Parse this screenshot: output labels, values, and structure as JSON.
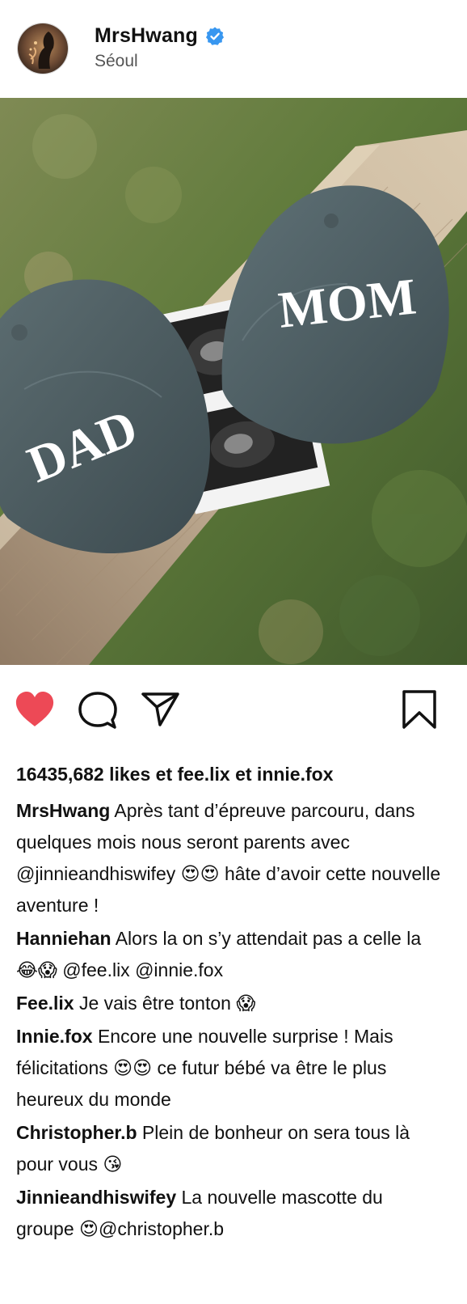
{
  "post": {
    "username": "MrsHwang",
    "verified": true,
    "location": "Séoul",
    "likes_text": "16435,682 likes et fee.lix et innie.fox",
    "liked": true
  },
  "icons": {
    "like": "heart-icon",
    "comment": "comment-bubble-icon",
    "share": "paper-plane-icon",
    "save": "bookmark-icon",
    "verified": "verified-badge-icon"
  },
  "colors": {
    "like_active": "#ED4956",
    "verified_blue": "#3897F0",
    "text": "#111111",
    "secondary_text": "#555555"
  },
  "photo": {
    "cap_left_text": "DAD",
    "cap_right_text": "MOM"
  },
  "caption": {
    "author": "MrsHwang",
    "segments": [
      " Après tant d’épreuve parcouru, dans quelques mois nous seront parents avec ",
      "@jinnieandhiswifey",
      " 😍😍 hâte d’avoir cette nouvelle aventure !"
    ]
  },
  "comments": [
    {
      "author": "Hanniehan",
      "text": " Alors la on s’y attendait pas a celle la 😂😱 ",
      "mentions": [
        "@fee.lix",
        "@innie.fox"
      ]
    },
    {
      "author": "Fee.lix",
      "text": "  Je vais être tonton 😱",
      "mentions": []
    },
    {
      "author": "Innie.fox",
      "text": " Encore une nouvelle surprise ! Mais félicitations 😍😍 ce futur bébé va être le plus heureux du monde",
      "mentions": []
    },
    {
      "author": "Christopher.b",
      "text": " Plein de bonheur on sera tous là pour vous 😘",
      "mentions": []
    },
    {
      "author": "Jinnieandhiswifey",
      "text": " La nouvelle mascotte du groupe 😍",
      "mentions": [
        "@christopher.b"
      ]
    }
  ]
}
